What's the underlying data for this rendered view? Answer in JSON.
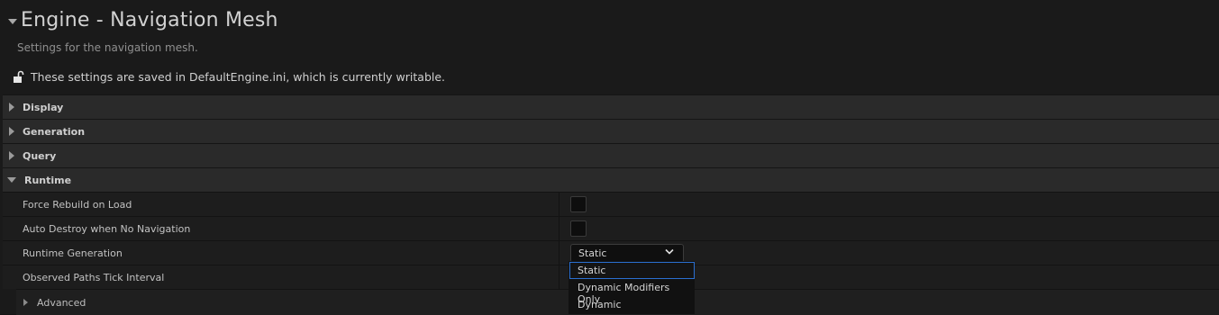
{
  "header": {
    "title": "Engine - Navigation Mesh",
    "subtitle": "Settings for the navigation mesh.",
    "writable_text": "These settings are saved in DefaultEngine.ini, which is currently writable."
  },
  "categories": {
    "display": "Display",
    "generation": "Generation",
    "query": "Query",
    "runtime": "Runtime"
  },
  "runtime": {
    "force_rebuild_label": "Force Rebuild on Load",
    "force_rebuild_checked": false,
    "auto_destroy_label": "Auto Destroy when No Navigation",
    "auto_destroy_checked": false,
    "runtime_generation_label": "Runtime Generation",
    "runtime_generation_value": "Static",
    "observed_paths_label": "Observed Paths Tick Interval",
    "advanced_label": "Advanced"
  },
  "dropdown": {
    "options": [
      "Static",
      "Dynamic Modifiers Only",
      "Dynamic"
    ],
    "selected": "Static"
  },
  "colors": {
    "background": "#1a1a1a",
    "category_bar": "#2a2a2a",
    "selection_border": "#2a6fd1"
  }
}
